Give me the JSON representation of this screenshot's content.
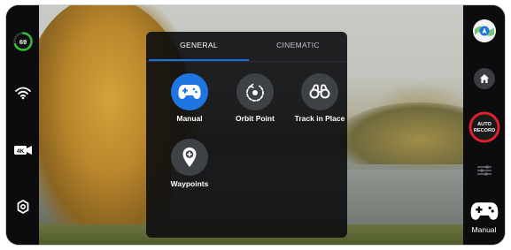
{
  "left_sidebar": {
    "battery_percent": "69",
    "battery_level": 0.69,
    "wifi_icon": "wifi-icon",
    "resolution_badge": "4K",
    "settings_icon": "gear-icon"
  },
  "panel": {
    "tabs": [
      {
        "label": "GENERAL",
        "active": true
      },
      {
        "label": "CINEMATIC",
        "active": false
      }
    ],
    "modes": [
      {
        "label": "Manual",
        "icon": "gamepad-icon",
        "active": true
      },
      {
        "label": "Orbit Point",
        "icon": "orbit-icon",
        "active": false
      },
      {
        "label": "Track in Place",
        "icon": "binoculars-icon",
        "active": false
      },
      {
        "label": "Waypoints",
        "icon": "map-pin-plus-icon",
        "active": false
      }
    ]
  },
  "right_sidebar": {
    "home_icon": "home-icon",
    "auto_record_line1": "AUTO",
    "auto_record_line2": "RECORD",
    "adjust_icon": "sliders-icon",
    "current_mode_label": "Manual"
  },
  "colors": {
    "accent_blue": "#1f76e3",
    "record_red": "#e0212a",
    "battery_green": "#2fbf3a"
  }
}
